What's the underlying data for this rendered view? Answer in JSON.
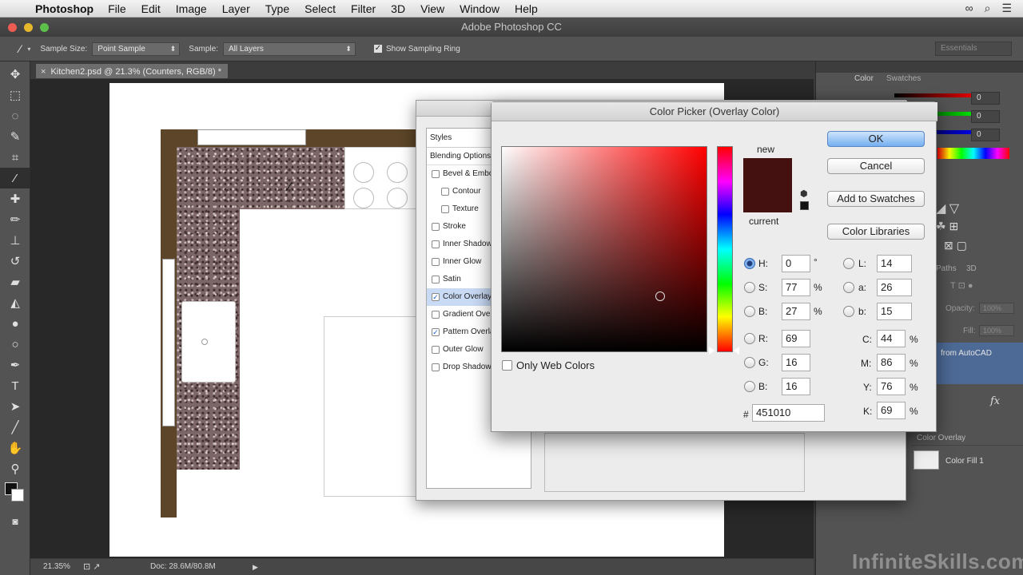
{
  "menubar": {
    "app": "Photoshop",
    "items": [
      "File",
      "Edit",
      "Image",
      "Layer",
      "Type",
      "Select",
      "Filter",
      "3D",
      "View",
      "Window",
      "Help"
    ]
  },
  "window": {
    "title": "Adobe Photoshop CC"
  },
  "options": {
    "sample_size_label": "Sample Size:",
    "sample_size_value": "Point Sample",
    "sample_label": "Sample:",
    "sample_value": "All Layers",
    "sampling_ring_label": "Show Sampling Ring",
    "workspace": "Essentials"
  },
  "document": {
    "tab_label": "Kitchen2.psd @ 21.3% (Counters, RGB/8) *"
  },
  "status": {
    "zoom": "21.35%",
    "doc_size": "Doc: 28.6M/80.8M"
  },
  "panels": {
    "color_tab": "Color",
    "swatches_tab": "Swatches",
    "slider_values": [
      "0",
      "0",
      "0"
    ],
    "paths_tab": "Paths",
    "threed_tab": "3D",
    "opacity_label": "Opacity:",
    "opacity_value": "100%",
    "fill_label": "Fill:",
    "fill_value": "100%",
    "layer_autocad": "from AutoCAD",
    "fx_label": "fx",
    "effect_color_overlay": "Color Overlay",
    "layer_color_fill": "Color Fill 1"
  },
  "layer_style": {
    "styles_header": "Styles",
    "items": [
      {
        "label": "Blending Options: Default",
        "checkbox": false,
        "checked": false
      },
      {
        "label": "Bevel & Emboss",
        "checkbox": true,
        "checked": false
      },
      {
        "label": "Contour",
        "checkbox": true,
        "checked": false,
        "indent": true
      },
      {
        "label": "Texture",
        "checkbox": true,
        "checked": false,
        "indent": true
      },
      {
        "label": "Stroke",
        "checkbox": true,
        "checked": false
      },
      {
        "label": "Inner Shadow",
        "checkbox": true,
        "checked": false
      },
      {
        "label": "Inner Glow",
        "checkbox": true,
        "checked": false
      },
      {
        "label": "Satin",
        "checkbox": true,
        "checked": false
      },
      {
        "label": "Color Overlay",
        "checkbox": true,
        "checked": true,
        "selected": true
      },
      {
        "label": "Gradient Overlay",
        "checkbox": true,
        "checked": false
      },
      {
        "label": "Pattern Overlay",
        "checkbox": true,
        "checked": true
      },
      {
        "label": "Outer Glow",
        "checkbox": true,
        "checked": false
      },
      {
        "label": "Drop Shadow",
        "checkbox": true,
        "checked": false
      }
    ]
  },
  "color_picker": {
    "title": "Color Picker (Overlay Color)",
    "new_label": "new",
    "current_label": "current",
    "new_color": "#451010",
    "current_color": "#451010",
    "ok": "OK",
    "cancel": "Cancel",
    "add_to_swatches": "Add to Swatches",
    "color_libraries": "Color Libraries",
    "only_web_colors": "Only Web Colors",
    "hsb": {
      "h_label": "H:",
      "h_value": "0",
      "h_unit": "°",
      "s_label": "S:",
      "s_value": "77",
      "s_unit": "%",
      "b_label": "B:",
      "b_value": "27",
      "b_unit": "%"
    },
    "rgb": {
      "r_label": "R:",
      "r_value": "69",
      "g_label": "G:",
      "g_value": "16",
      "b_label": "B:",
      "b_value": "16"
    },
    "lab": {
      "l_label": "L:",
      "l_value": "14",
      "a_label": "a:",
      "a_value": "26",
      "b_label": "b:",
      "b_value": "15"
    },
    "cmyk": {
      "c_label": "C:",
      "c_value": "44",
      "m_label": "M:",
      "m_value": "86",
      "y_label": "Y:",
      "y_value": "76",
      "k_label": "K:",
      "k_value": "69",
      "unit": "%"
    },
    "hex_label": "#",
    "hex_value": "451010",
    "selected_mode": "H"
  },
  "watermark": "InfiniteSkills.com"
}
